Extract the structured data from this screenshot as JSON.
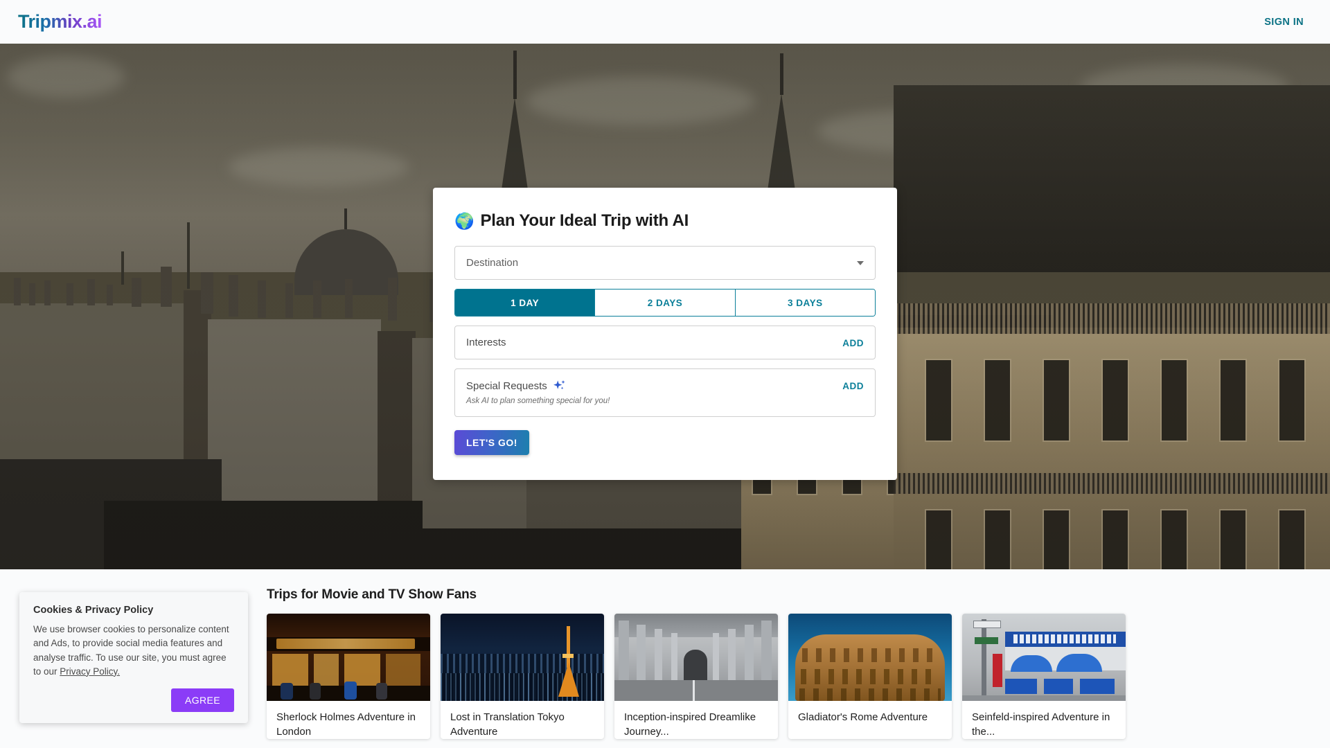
{
  "header": {
    "logo": "Tripmix.ai",
    "sign_in": "SIGN IN",
    "accent_teal": "#0b7285",
    "accent_purple": "#a855f7"
  },
  "planner": {
    "globe_icon": "🌍",
    "title": "Plan Your Ideal Trip with AI",
    "destination": {
      "label": "Destination",
      "value": "",
      "placeholder": "Destination",
      "caret_icon": "chevron-down-icon"
    },
    "duration_tabs": [
      {
        "label": "1 DAY",
        "active": true
      },
      {
        "label": "2 DAYS",
        "active": false
      },
      {
        "label": "3 DAYS",
        "active": false
      }
    ],
    "interests": {
      "label": "Interests",
      "add_label": "ADD"
    },
    "special_requests": {
      "label": "Special Requests",
      "sparkle_icon": "sparkle-icon",
      "hint": "Ask AI to plan something special for you!",
      "add_label": "ADD"
    },
    "submit_label": "LET'S GO!",
    "active_tab_color": "#00738f",
    "submit_gradient_from": "#5b4bd6",
    "submit_gradient_to": "#1d7fae"
  },
  "trips": {
    "section_title": "Trips for Movie and TV Show Fans",
    "cards": [
      {
        "title": "Sherlock Holmes Adventure in London",
        "image": "sherlock-holmes-pub-london"
      },
      {
        "title": "Lost in Translation Tokyo Adventure",
        "image": "tokyo-night-skyline"
      },
      {
        "title": "Inception-inspired Dreamlike Journey...",
        "image": "bir-hakeim-bridge-paris"
      },
      {
        "title": "Gladiator's Rome Adventure",
        "image": "colosseum-rome"
      },
      {
        "title": "Seinfeld-inspired Adventure in the...",
        "image": "toms-restaurant-new-york"
      }
    ]
  },
  "cookie_banner": {
    "title": "Cookies & Privacy Policy",
    "text_before_link": "We use browser cookies to personalize content and Ads, to provide social media features and analyse traffic. To use our site, you must agree to our ",
    "link_label": "Privacy Policy.",
    "agree_label": "AGREE",
    "agree_color": "#8b3cf7"
  },
  "hero": {
    "image_description": "paris-rooftops-eiffel-tower"
  }
}
